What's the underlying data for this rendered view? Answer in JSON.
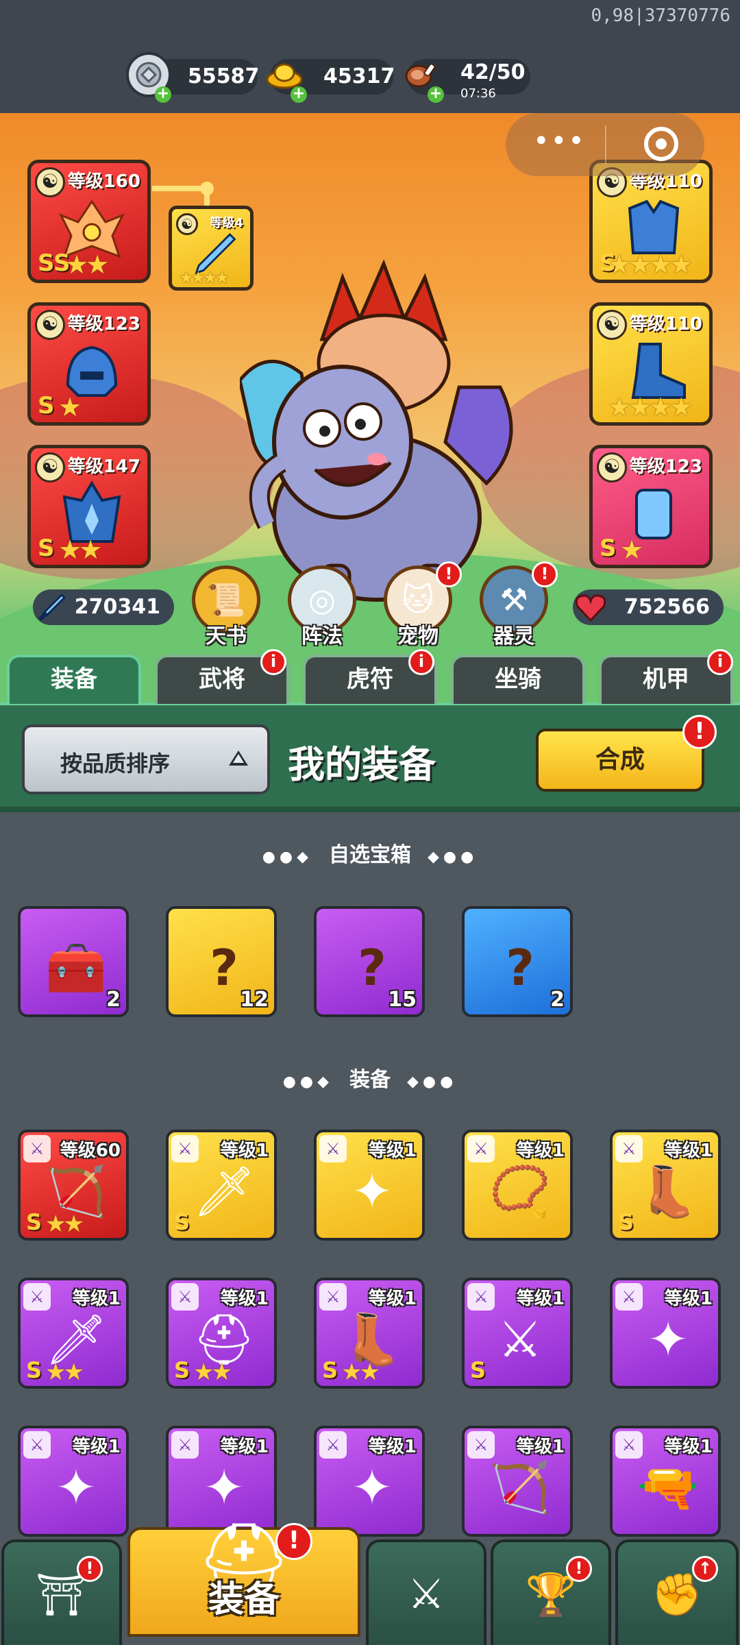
{
  "build_tag": "0,98|37370776",
  "currencies": [
    {
      "icon": "silver-coin-icon",
      "value": "55587"
    },
    {
      "icon": "gold-ingot-icon",
      "value": "45317"
    },
    {
      "icon": "meat-stamina-icon",
      "value": "42/50",
      "timer": "07:36"
    }
  ],
  "hero": {
    "attack": "270341",
    "hp": "752566",
    "left_slots": [
      {
        "level": "等级160",
        "grade": "SS",
        "stars": "★★",
        "color": "red"
      },
      {
        "level": "等级123",
        "grade": "S",
        "stars": "★",
        "color": "red"
      },
      {
        "level": "等级147",
        "grade": "S",
        "stars": "★★",
        "color": "red"
      }
    ],
    "sub_slot": {
      "level": "等级4",
      "stars": "★★★★"
    },
    "right_slots": [
      {
        "level": "等级110",
        "grade": "S",
        "stars": "★★★★",
        "color": "gold"
      },
      {
        "level": "等级110",
        "grade": "",
        "stars": "★★★★",
        "color": "gold"
      },
      {
        "level": "等级123",
        "grade": "S",
        "stars": "★",
        "color": "pink"
      }
    ],
    "features": [
      {
        "label": "天书",
        "icon": "scroll-icon",
        "badge": false
      },
      {
        "label": "阵法",
        "icon": "formation-icon",
        "badge": false
      },
      {
        "label": "宠物",
        "icon": "pet-cat-icon",
        "badge": true
      },
      {
        "label": "器灵",
        "icon": "spirit-icon",
        "badge": true
      }
    ]
  },
  "tabs": [
    {
      "label": "装备",
      "active": true,
      "badge": false
    },
    {
      "label": "武将",
      "active": false,
      "badge": true
    },
    {
      "label": "虎符",
      "active": false,
      "badge": true
    },
    {
      "label": "坐骑",
      "active": false,
      "badge": false
    },
    {
      "label": "机甲",
      "active": false,
      "badge": true
    }
  ],
  "panel": {
    "sort_label": "按品质排序",
    "title": "我的装备",
    "synth_label": "合成"
  },
  "chest_section": {
    "title": "自选宝箱",
    "items": [
      {
        "count": "2",
        "color": "purple",
        "icon": "treasure-chest-icon"
      },
      {
        "count": "12",
        "color": "gold",
        "icon": "mystery-chest-icon"
      },
      {
        "count": "15",
        "color": "purple",
        "icon": "mystery-chest-icon"
      },
      {
        "count": "2",
        "color": "blue",
        "icon": "mystery-chest-icon"
      }
    ]
  },
  "equip_section": {
    "title": "装备",
    "items": [
      {
        "level": "等级60",
        "grade": "S",
        "stars": "★★",
        "color": "red",
        "icon": "crossbow-icon"
      },
      {
        "level": "等级1",
        "grade": "S",
        "stars": "",
        "color": "gold",
        "icon": "ice-sword-icon"
      },
      {
        "level": "等级1",
        "grade": "",
        "stars": "",
        "color": "gold",
        "icon": "shuriken-icon"
      },
      {
        "level": "等级1",
        "grade": "",
        "stars": "",
        "color": "gold",
        "icon": "amulet-icon"
      },
      {
        "level": "等级1",
        "grade": "S",
        "stars": "",
        "color": "gold",
        "icon": "ice-boots-icon"
      },
      {
        "level": "等级1",
        "grade": "S",
        "stars": "★★",
        "color": "purple",
        "icon": "ice-sword-icon"
      },
      {
        "level": "等级1",
        "grade": "S",
        "stars": "★★",
        "color": "purple",
        "icon": "ice-helmet-icon"
      },
      {
        "level": "等级1",
        "grade": "S",
        "stars": "★★",
        "color": "purple",
        "icon": "ice-boots-icon"
      },
      {
        "level": "等级1",
        "grade": "S",
        "stars": "",
        "color": "purple",
        "icon": "dragon-blade-icon"
      },
      {
        "level": "等级1",
        "grade": "",
        "stars": "",
        "color": "purple",
        "icon": "shuriken-icon"
      },
      {
        "level": "等级1",
        "grade": "",
        "stars": "",
        "color": "purple",
        "icon": "shuriken-icon"
      },
      {
        "level": "等级1",
        "grade": "",
        "stars": "",
        "color": "purple",
        "icon": "shuriken-icon"
      },
      {
        "level": "等级1",
        "grade": "",
        "stars": "",
        "color": "purple",
        "icon": "shuriken-icon"
      },
      {
        "level": "等级1",
        "grade": "",
        "stars": "",
        "color": "purple",
        "icon": "bow-icon"
      },
      {
        "level": "等级1",
        "grade": "",
        "stars": "",
        "color": "purple",
        "icon": "gun-icon"
      }
    ]
  },
  "bottom_nav": [
    {
      "label": "",
      "icon": "shop-gate-icon",
      "badge": true
    },
    {
      "label": "装备",
      "icon": "helmet-icon",
      "badge": true,
      "active": true
    },
    {
      "label": "",
      "icon": "shield-crossed-icon",
      "badge": false
    },
    {
      "label": "",
      "icon": "tower-stars-icon",
      "badge": true
    },
    {
      "label": "",
      "icon": "fist-upgrade-icon",
      "badge": true
    }
  ]
}
